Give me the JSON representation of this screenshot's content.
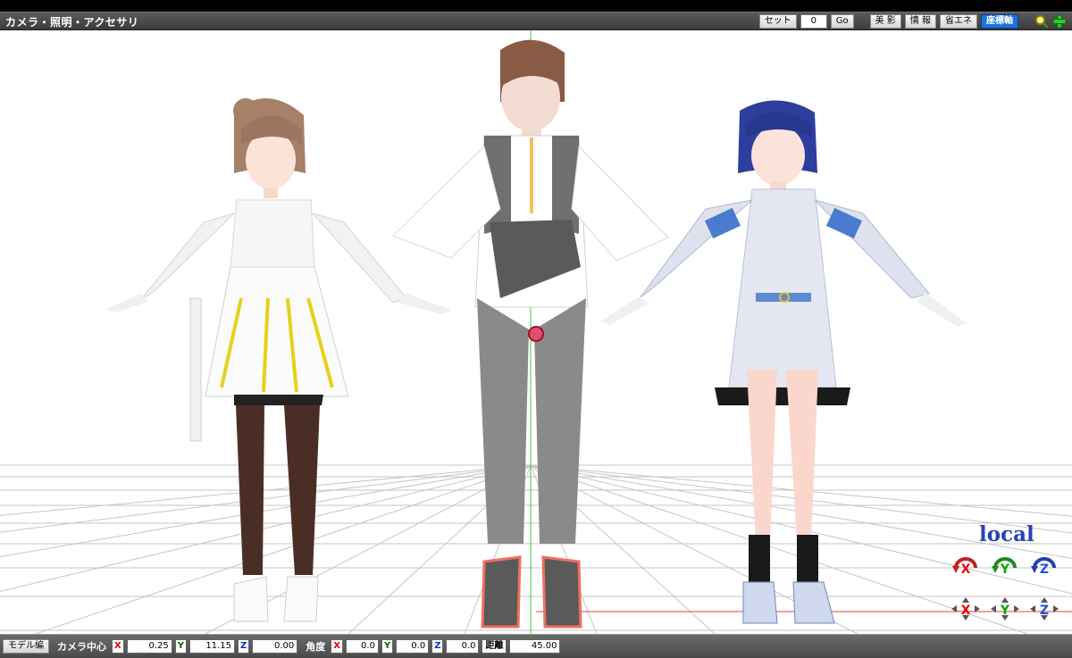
{
  "window": {
    "title": "カメラ・照明・アクセサリ"
  },
  "toolbar": {
    "set_label": "セット",
    "frame_value": "0",
    "go_label": "Go",
    "beauty_label": "美 影",
    "info_label": "情 報",
    "eco_label": "省エネ",
    "axis_label": "座標軸"
  },
  "icons": {
    "zoom": "zoom-icon",
    "add": "add-icon",
    "gizmo_x": "rotate-x-icon",
    "gizmo_y": "rotate-y-icon",
    "gizmo_z": "rotate-z-icon"
  },
  "viewport": {
    "mode_label": "local"
  },
  "gizmos": {
    "x": "X",
    "y": "Y",
    "z": "Z"
  },
  "statusbar": {
    "model_edit_label": "モデル編",
    "camera_center_label": "カメラ中心",
    "angle_label": "角度",
    "distance_label": "距離",
    "axis_x": "X",
    "axis_y": "Y",
    "axis_z": "Z",
    "camera_x": "0.25",
    "camera_y": "11.15",
    "camera_z": "0.00",
    "angle_x": "0.0",
    "angle_y": "0.0",
    "angle_z": "0.0",
    "distance": "45.00"
  },
  "colors": {
    "accent_blue": "#1e73e0",
    "axis_x": "#dd0000",
    "axis_y": "#007700",
    "axis_z": "#1030c0",
    "local_text": "#2b3fb8"
  }
}
